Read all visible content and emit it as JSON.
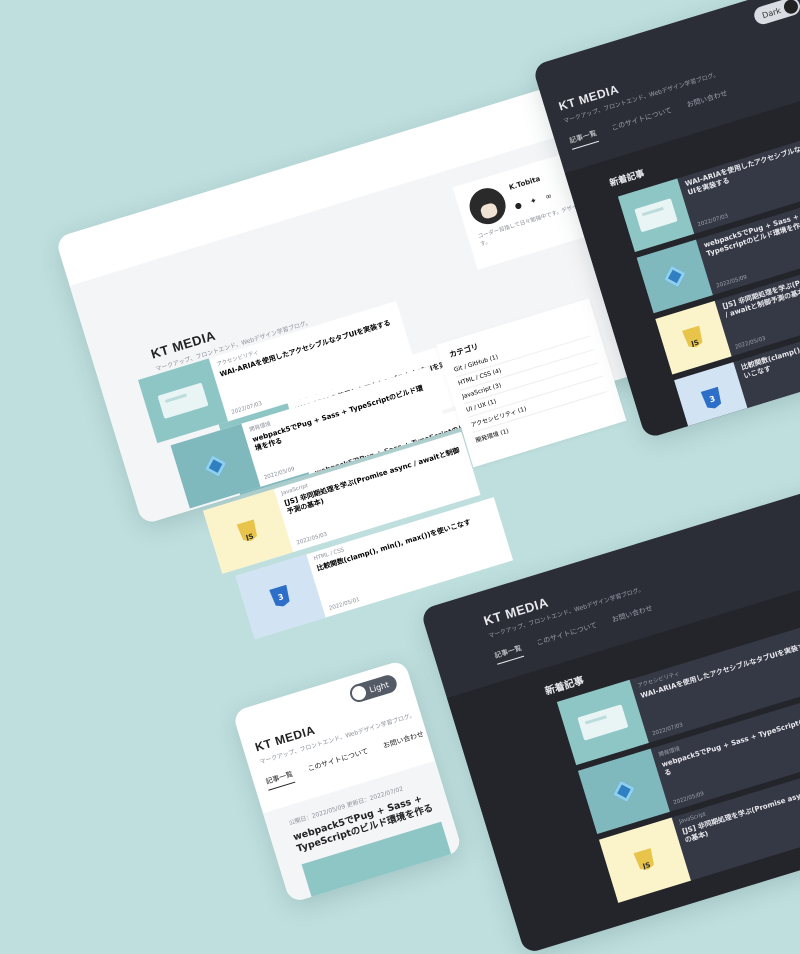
{
  "site": {
    "logo": "KT MEDIA",
    "tagline": "マークアップ、フロントエンド、Webデザイン学習ブログ。",
    "nav": [
      "記事一覧",
      "このサイトについて",
      "お問い合わせ"
    ]
  },
  "theme": {
    "light_label": "Light",
    "dark_label": "Dark"
  },
  "section_title": "新着記事",
  "articles": [
    {
      "category": "アクセシビリティ",
      "title": "WAI-ARIAを使用したアクセシブルなタブUIを実装する",
      "date": "2022/07/03",
      "thumb": "site-thumbnail"
    },
    {
      "category": "開発環境",
      "title": "webpack5でPug + Sass + TypeScriptのビルド環境を作る",
      "date": "2022/05/09",
      "thumb": "webpack-cube-icon"
    },
    {
      "category": "JavaScript",
      "title": "[JS] 非同期処理を学ぶ(Promise async / awaitと制御予測の基本)",
      "date": "2022/05/03",
      "thumb": "javascript-shield-icon"
    },
    {
      "category": "HTML / CSS",
      "title": "比較関数(clamp(), min(), max())を使いこなす",
      "date": "2022/05/01",
      "thumb": "css3-shield-icon"
    }
  ],
  "profile": {
    "name": "K.Tobita",
    "bio": "コーダー目指して日々勉強中です。デザインもコーディングも大好きです。",
    "icons": [
      "github-icon",
      "twitter-icon",
      "link-icon"
    ]
  },
  "categories": {
    "title": "カテゴリ",
    "items": [
      "Git / GitHub (1)",
      "HTML / CSS (4)",
      "JavaScript (3)",
      "UI / UX (1)",
      "アクセシビリティ (1)",
      "開発環境 (1)"
    ]
  },
  "article_page": {
    "published": "公開日：2022/05/09",
    "updated": "更新日：2022/07/02",
    "title": "webpack5でPug + Sass + TypeScriptのビルド環境を作る"
  },
  "colors": {
    "background": "#bfdfdf",
    "dark_surface": "#2b2e36",
    "accent_teal": "#8ec6c6"
  }
}
